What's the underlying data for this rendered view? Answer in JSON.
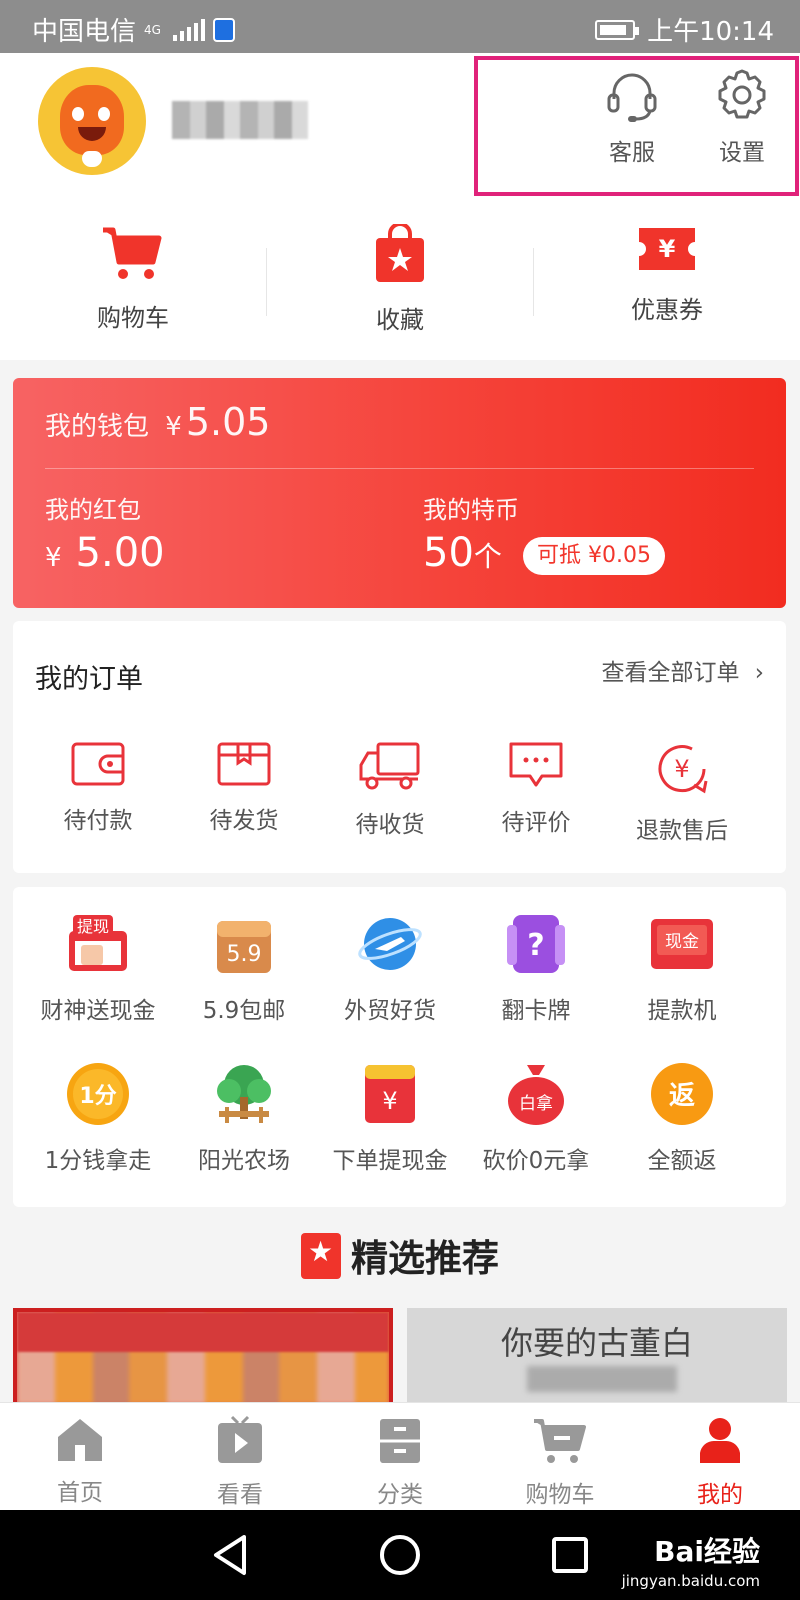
{
  "status_bar": {
    "carrier": "中国电信",
    "network": "4G",
    "time": "上午10:14"
  },
  "header": {
    "service_label": "客服",
    "settings_label": "设置"
  },
  "quick_actions": [
    {
      "label": "购物车",
      "icon": "shopping-cart-icon"
    },
    {
      "label": "收藏",
      "icon": "favorites-bag-icon"
    },
    {
      "label": "优惠券",
      "icon": "coupon-icon"
    }
  ],
  "wallet": {
    "title": "我的钱包",
    "currency": "¥",
    "balance": "5.05",
    "red_packet_label": "我的红包",
    "red_packet_currency": "¥",
    "red_packet_value": "5.00",
    "coins_label": "我的特币",
    "coins_value": "50",
    "coins_unit": "个",
    "deduct_label": "可抵 ¥0.05"
  },
  "orders": {
    "title": "我的订单",
    "view_all": "查看全部订单",
    "items": [
      {
        "label": "待付款",
        "icon": "wallet-icon"
      },
      {
        "label": "待发货",
        "icon": "package-icon"
      },
      {
        "label": "待收货",
        "icon": "truck-icon"
      },
      {
        "label": "待评价",
        "icon": "comment-icon"
      },
      {
        "label": "退款售后",
        "icon": "refund-icon"
      }
    ]
  },
  "features": {
    "row1": [
      {
        "label": "财神送现金",
        "badge": "提现"
      },
      {
        "label": "5.9包邮",
        "badge": "5.9"
      },
      {
        "label": "外贸好货",
        "badge": ""
      },
      {
        "label": "翻卡牌",
        "badge": "?"
      },
      {
        "label": "提款机",
        "badge": "现金"
      }
    ],
    "row2": [
      {
        "label": "1分钱拿走",
        "badge": "1分"
      },
      {
        "label": "阳光农场",
        "badge": ""
      },
      {
        "label": "下单提现金",
        "badge": "¥"
      },
      {
        "label": "砍价0元拿",
        "badge": "白拿"
      },
      {
        "label": "全额返",
        "badge": "返"
      }
    ]
  },
  "recommend": {
    "title": "精选推荐",
    "card2_text": "你要的古董白"
  },
  "bottom_nav": [
    {
      "label": "首页",
      "icon": "home-icon",
      "active": false
    },
    {
      "label": "看看",
      "icon": "video-icon",
      "active": false
    },
    {
      "label": "分类",
      "icon": "category-icon",
      "active": false
    },
    {
      "label": "购物车",
      "icon": "cart-icon",
      "active": false
    },
    {
      "label": "我的",
      "icon": "profile-icon",
      "active": true
    }
  ],
  "watermark": {
    "brand": "Bai经验",
    "url": "jingyan.baidu.com"
  },
  "colors": {
    "accent": "#f0342b",
    "highlight_box": "#e0227a"
  }
}
